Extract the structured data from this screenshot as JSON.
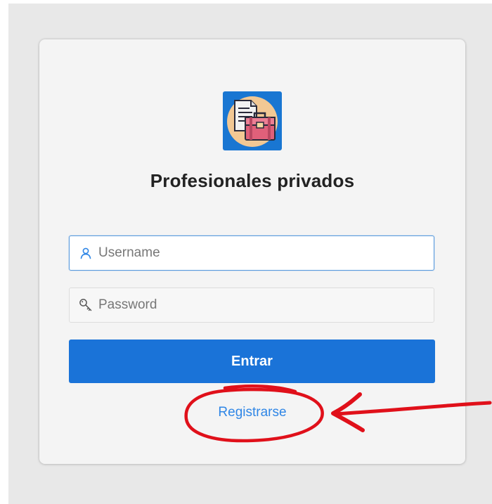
{
  "login": {
    "title": "Profesionales privados",
    "username": {
      "placeholder": "Username",
      "value": ""
    },
    "password": {
      "placeholder": "Password",
      "value": ""
    },
    "submit_label": "Entrar",
    "register_label": "Registrarse"
  },
  "icons": {
    "logo": "briefcase-document-logo",
    "username": "user-icon",
    "password": "key-icon"
  },
  "colors": {
    "primary": "#1a73d8",
    "link": "#2f86e6",
    "focus_border": "#5b9bdd",
    "card_background": "#f4f4f4",
    "logo_background": "#1976d2",
    "logo_circle": "#f2c894",
    "annotation": "#e0101a"
  }
}
